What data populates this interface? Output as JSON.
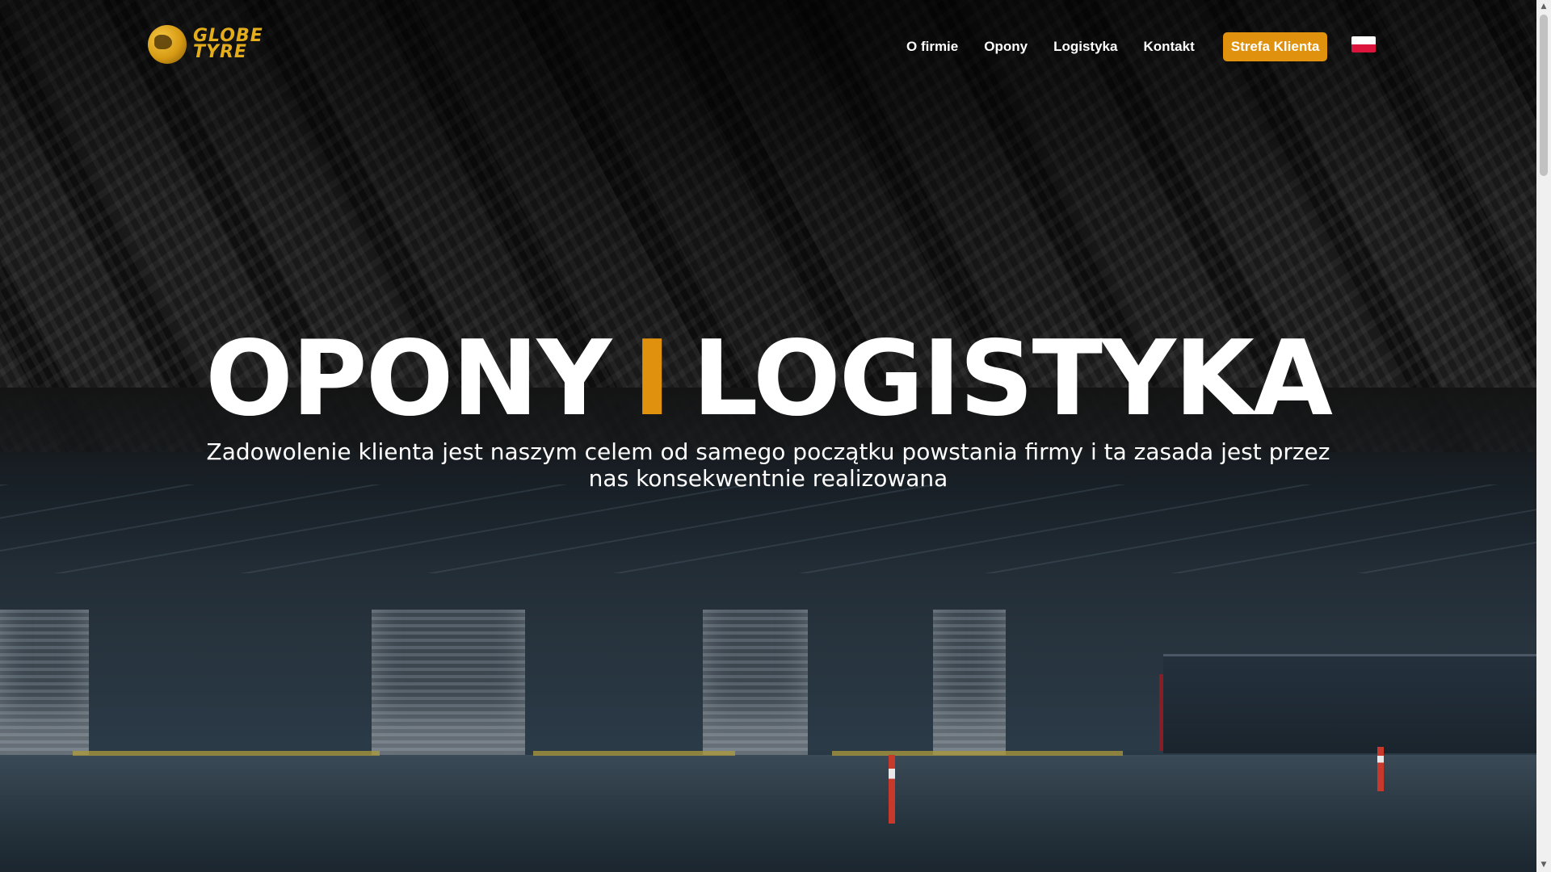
{
  "header": {
    "logo": {
      "line1": "GLOBE",
      "line2": "TYRE"
    },
    "nav": [
      {
        "label": "O firmie"
      },
      {
        "label": "Opony"
      },
      {
        "label": "Logistyka"
      },
      {
        "label": "Kontakt"
      }
    ],
    "cta_label": "Strefa Klienta",
    "language_flag": "poland-flag-icon"
  },
  "hero": {
    "title_left": "OPONY",
    "separator": "I",
    "title_right": "LOGISTYKA",
    "subtitle": "Zadowolenie klienta jest naszym celem od samego początku powstania firmy i ta zasada jest przez nas konsekwentnie realizowana"
  },
  "colors": {
    "accent": "#e0920f",
    "logo_gold": "#e3ad1c",
    "text": "#ffffff"
  }
}
